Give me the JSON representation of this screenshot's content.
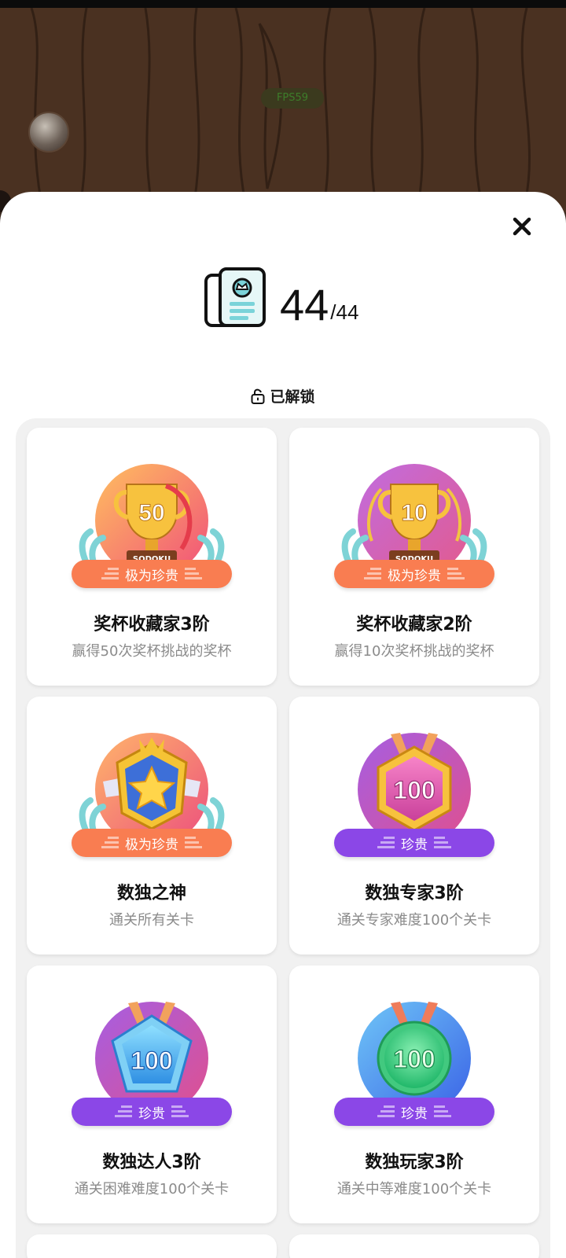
{
  "background": {
    "fps_label": "FPS59"
  },
  "header": {
    "unlocked_count": "44",
    "total_count": "/44"
  },
  "section": {
    "label": "已解锁"
  },
  "cards": [
    {
      "title": "奖杯收藏家3阶",
      "desc": "赢得50次奖杯挑战的奖杯",
      "rarity": "极为珍贵",
      "badge_text": "50",
      "plate": "SODOKU",
      "rarity_color": "#f97d51"
    },
    {
      "title": "奖杯收藏家2阶",
      "desc": "赢得10次奖杯挑战的奖杯",
      "rarity": "极为珍贵",
      "badge_text": "10",
      "plate": "SODOKU",
      "rarity_color": "#f97d51"
    },
    {
      "title": "数独之神",
      "desc": "通关所有关卡",
      "rarity": "极为珍贵",
      "badge_text": "",
      "rarity_color": "#f97d51"
    },
    {
      "title": "数独专家3阶",
      "desc": "通关专家难度100个关卡",
      "rarity": "珍贵",
      "badge_text": "100",
      "rarity_color": "#8b47e7"
    },
    {
      "title": "数独达人3阶",
      "desc": "通关困难难度100个关卡",
      "rarity": "珍贵",
      "badge_text": "100",
      "rarity_color": "#8b47e7"
    },
    {
      "title": "数独玩家3阶",
      "desc": "通关中等难度100个关卡",
      "rarity": "珍贵",
      "badge_text": "100",
      "rarity_color": "#8b47e7"
    }
  ],
  "icons": {
    "close": "close-icon",
    "unlock": "unlock-icon",
    "collection": "card-collection-icon"
  }
}
